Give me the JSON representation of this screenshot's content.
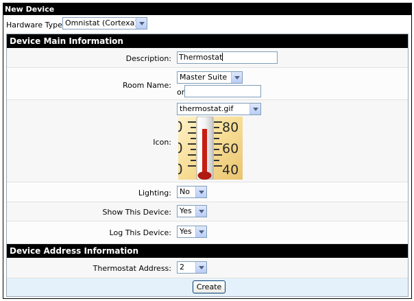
{
  "panel": {
    "title": "New Device"
  },
  "hardware": {
    "label": "Hardware Type:",
    "value": "Omnistat (Cortexa)"
  },
  "main_section": {
    "title": "Device Main Information"
  },
  "description": {
    "label": "Description:",
    "value": "Thermostat"
  },
  "room": {
    "label": "Room Name:",
    "value": "Master Suite",
    "or_label": "or",
    "new_value": ""
  },
  "icon": {
    "label": "Icon:",
    "value": "thermostat.gif",
    "image": "thermometer-icon"
  },
  "lighting": {
    "label": "Lighting:",
    "value": "No"
  },
  "show_device": {
    "label": "Show This Device:",
    "value": "Yes"
  },
  "log_device": {
    "label": "Log This Device:",
    "value": "Yes"
  },
  "address_section": {
    "title": "Device Address Information"
  },
  "thermostat_address": {
    "label": "Thermostat Address:",
    "value": "2"
  },
  "actions": {
    "create_label": "Create"
  },
  "colors": {
    "header_bg": "#000000",
    "row_bg": "#f7f7f7",
    "footer_bg": "#e4f1fb",
    "field_border": "#7f9db9"
  }
}
